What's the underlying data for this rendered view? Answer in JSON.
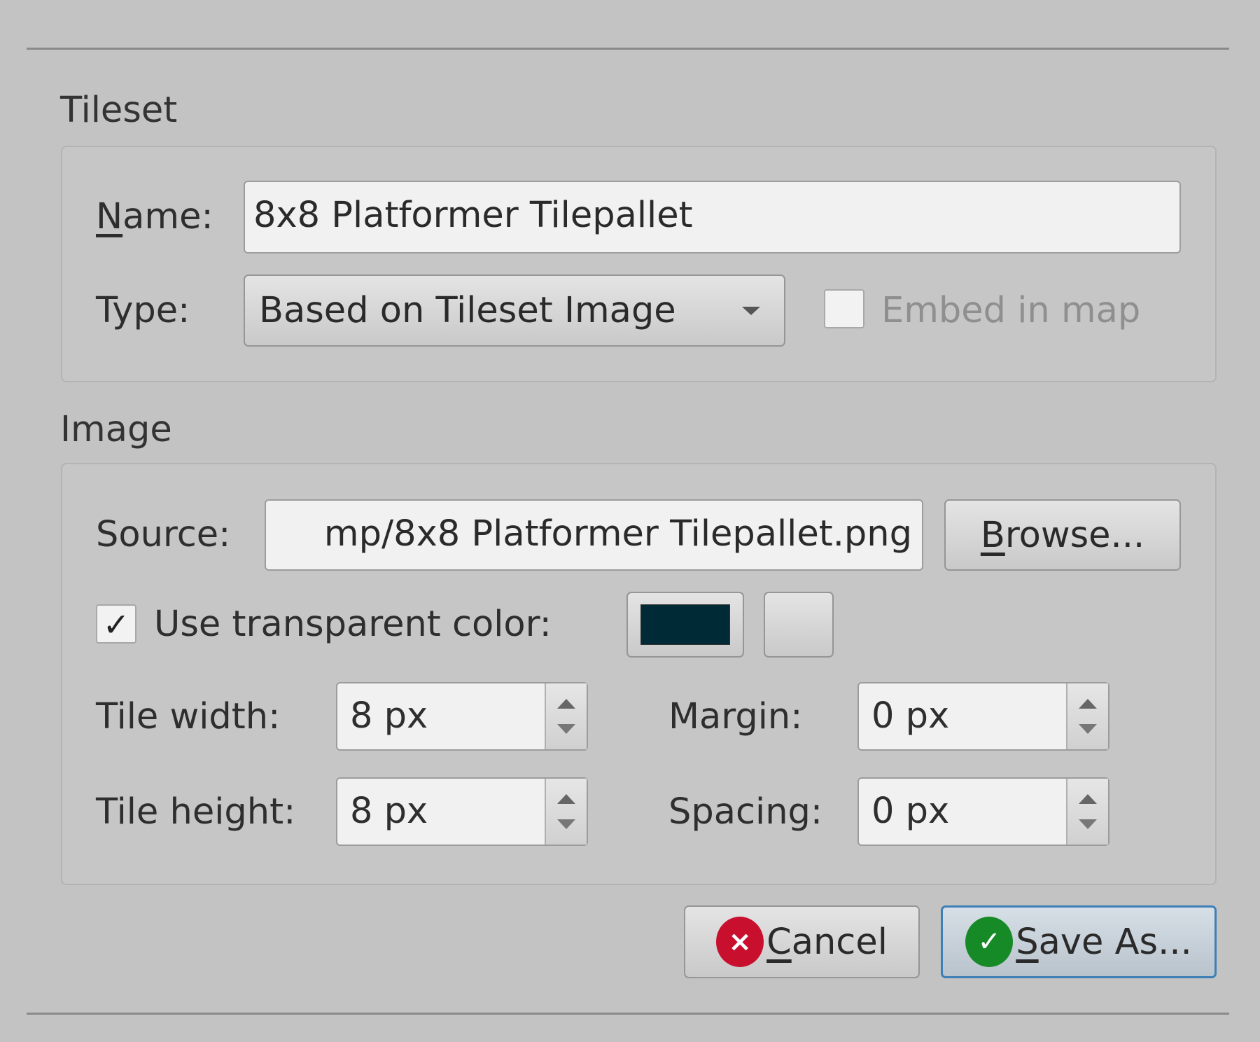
{
  "tileset": {
    "title": "Tileset",
    "name_label": "Name:",
    "name_value": "8x8 Platformer Tilepallet",
    "type_label": "Type:",
    "type_value": "Based on Tileset Image",
    "embed_label": "Embed in map",
    "embed_checked": false
  },
  "image": {
    "title": "Image",
    "source_label": "Source:",
    "source_value": "mp/8x8 Platformer Tilepallet.png",
    "browse_label": "Browse...",
    "transparent_label": "Use transparent color:",
    "transparent_checked": true,
    "check_glyph": "✓",
    "transparent_color": "#002b36",
    "tile_width_label": "Tile width:",
    "tile_width_value": "8 px",
    "tile_height_label": "Tile height:",
    "tile_height_value": "8 px",
    "margin_label": "Margin:",
    "margin_value": "0 px",
    "spacing_label": "Spacing:",
    "spacing_value": "0 px"
  },
  "buttons": {
    "cancel_label": "Cancel",
    "cancel_icon": "×",
    "save_label": "Save As...",
    "save_icon": "✓"
  },
  "colors": {
    "cancel_icon": "#c8102e",
    "save_icon": "#178a28",
    "focus_border": "#3d7fb6"
  }
}
